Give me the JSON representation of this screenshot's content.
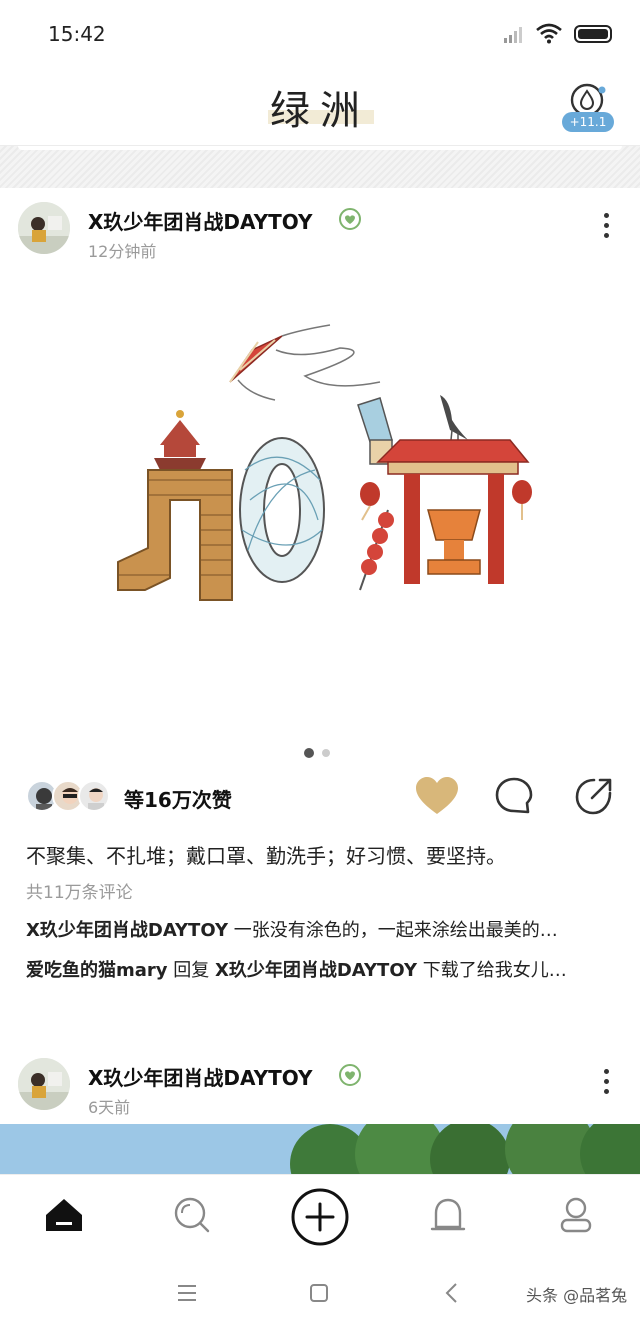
{
  "status_bar": {
    "time": "15:42"
  },
  "header": {
    "title": "绿洲",
    "badge": "+11.1"
  },
  "posts": [
    {
      "author": "X玖少年团肖战DAYTOY",
      "time": "12分钟前",
      "like_count": "等16万次赞",
      "caption": "不聚集、不扎堆；戴口罩、勤洗手；好习惯、要坚持。",
      "comment_total": "共11万条评论",
      "comments": [
        {
          "user": "X玖少年团肖战DAYTOY",
          "text": "一张没有涂色的，一起来涂绘出最美的…"
        },
        {
          "user": "爱吃鱼的猫mary",
          "reply_word": "回复",
          "reply_to": "X玖少年团肖战DAYTOY",
          "text": "下载了给我女儿…"
        }
      ],
      "page_indicator": {
        "count": 2,
        "active": 1
      }
    },
    {
      "author": "X玖少年团肖战DAYTOY",
      "time": "6天前"
    }
  ],
  "watermark": "头条 @品茗兔",
  "colors": {
    "heart": "#d8b77a",
    "badge": "#68a9d9",
    "verified": "#7fb46e"
  }
}
